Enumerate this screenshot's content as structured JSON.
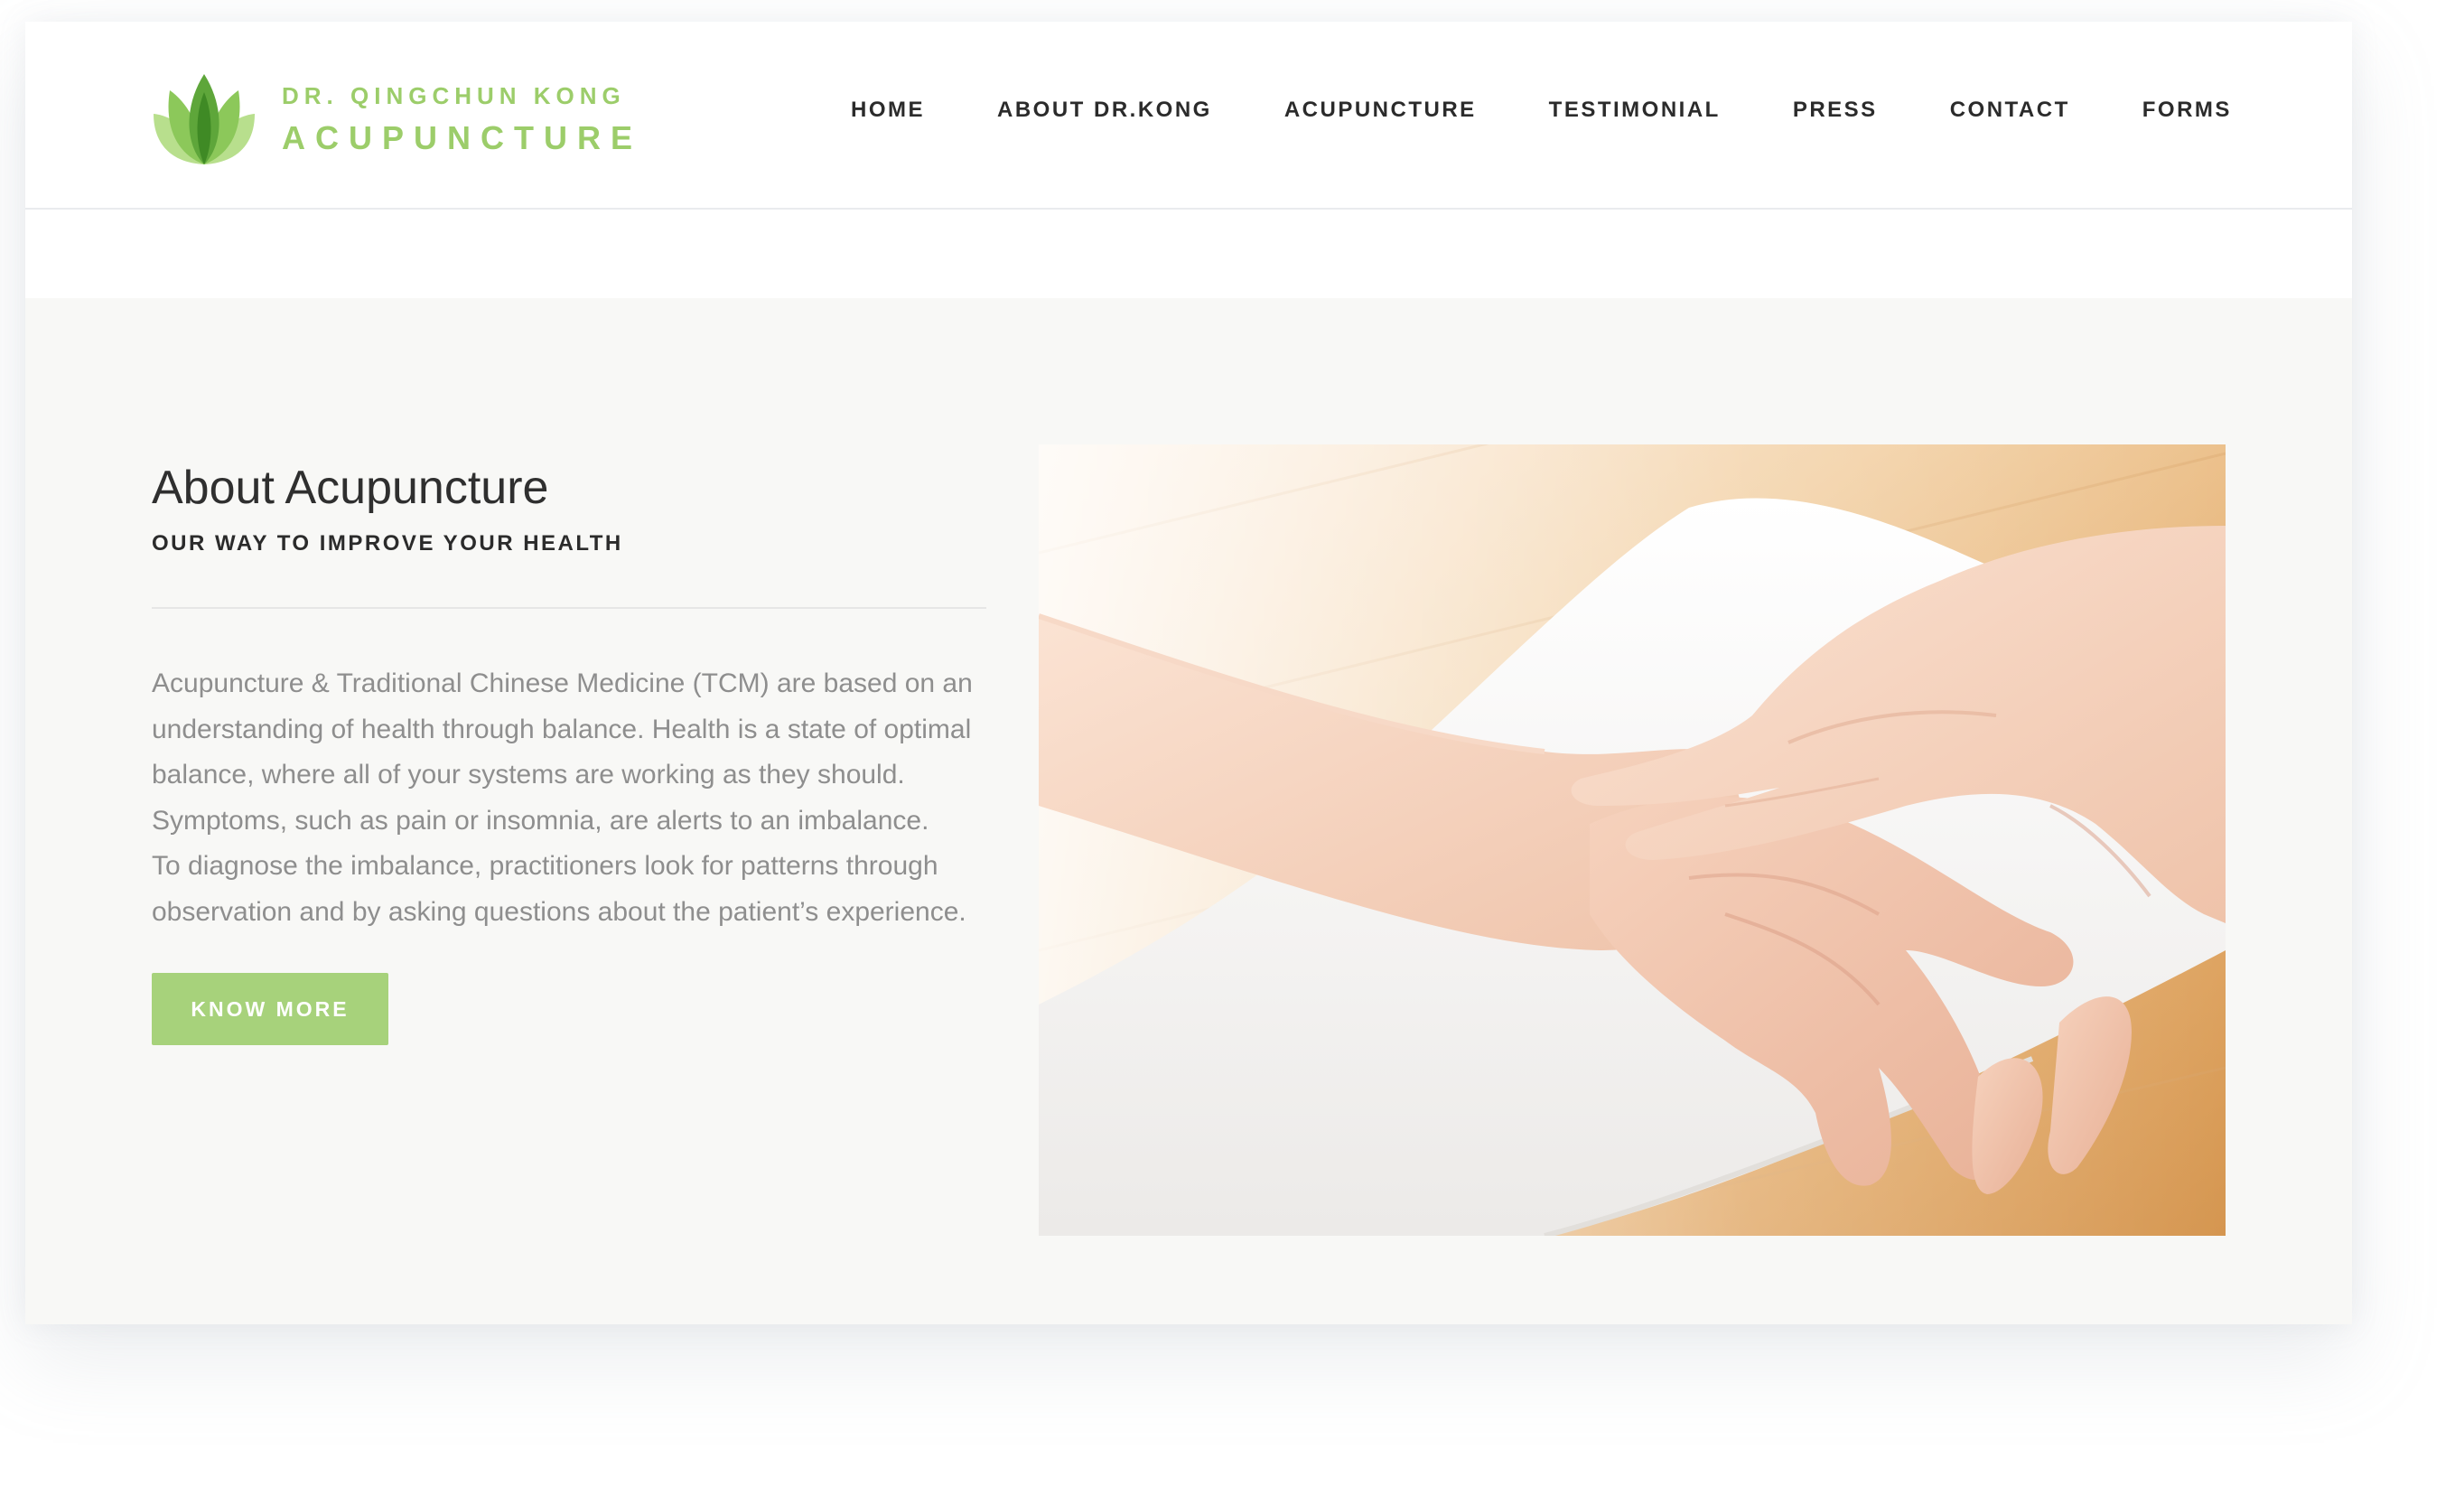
{
  "brand": {
    "line1": "DR. QINGCHUN KONG",
    "line2": "ACUPUNCTURE",
    "accent_color": "#9ccd6a"
  },
  "nav": {
    "items": [
      {
        "label": "HOME"
      },
      {
        "label": "ABOUT DR.KONG"
      },
      {
        "label": "ACUPUNCTURE"
      },
      {
        "label": "TESTIMONIAL"
      },
      {
        "label": "PRESS"
      },
      {
        "label": "CONTACT"
      },
      {
        "label": "FORMS"
      }
    ]
  },
  "about": {
    "title": "About Acupuncture",
    "subtitle": "OUR WAY TO IMPROVE YOUR HEALTH",
    "paragraph1": "Acupuncture & Traditional Chinese Medicine (TCM) are based on an understanding of health through balance. Health is a state of optimal balance, where all of your systems are working as they should. Symptoms, such as pain or insomnia, are alerts to an imbalance.",
    "paragraph2": "To diagnose the imbalance, practitioners look for patterns through observation and by asking questions about the patient’s experience.",
    "button_label": "KNOW MORE",
    "button_color": "#a7d27b"
  },
  "image": {
    "subject": "pulse-diagnosis-photo"
  }
}
